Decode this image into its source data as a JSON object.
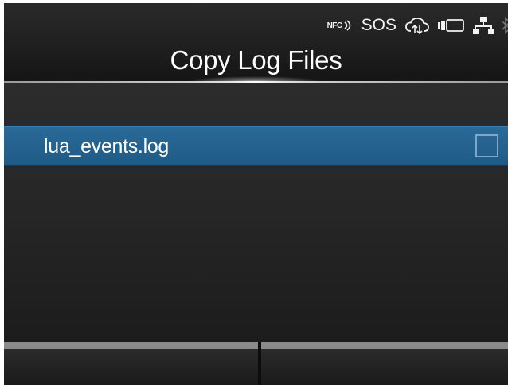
{
  "status_bar": {
    "nfc_label": "NFC",
    "sos_label": "SOS",
    "icons": [
      "nfc-icon",
      "cloud-sync-icon",
      "battery-icon",
      "network-icon",
      "bluetooth-icon"
    ]
  },
  "header": {
    "title": "Copy Log Files"
  },
  "list": {
    "items": [
      {
        "label": "lua_events.log",
        "selected": true,
        "checked": false
      }
    ]
  },
  "softkeys": {
    "left_label": "",
    "right_label": ""
  },
  "colors": {
    "selection": "#1f5a86",
    "background": "#1b1b1b",
    "text": "#ffffff"
  }
}
